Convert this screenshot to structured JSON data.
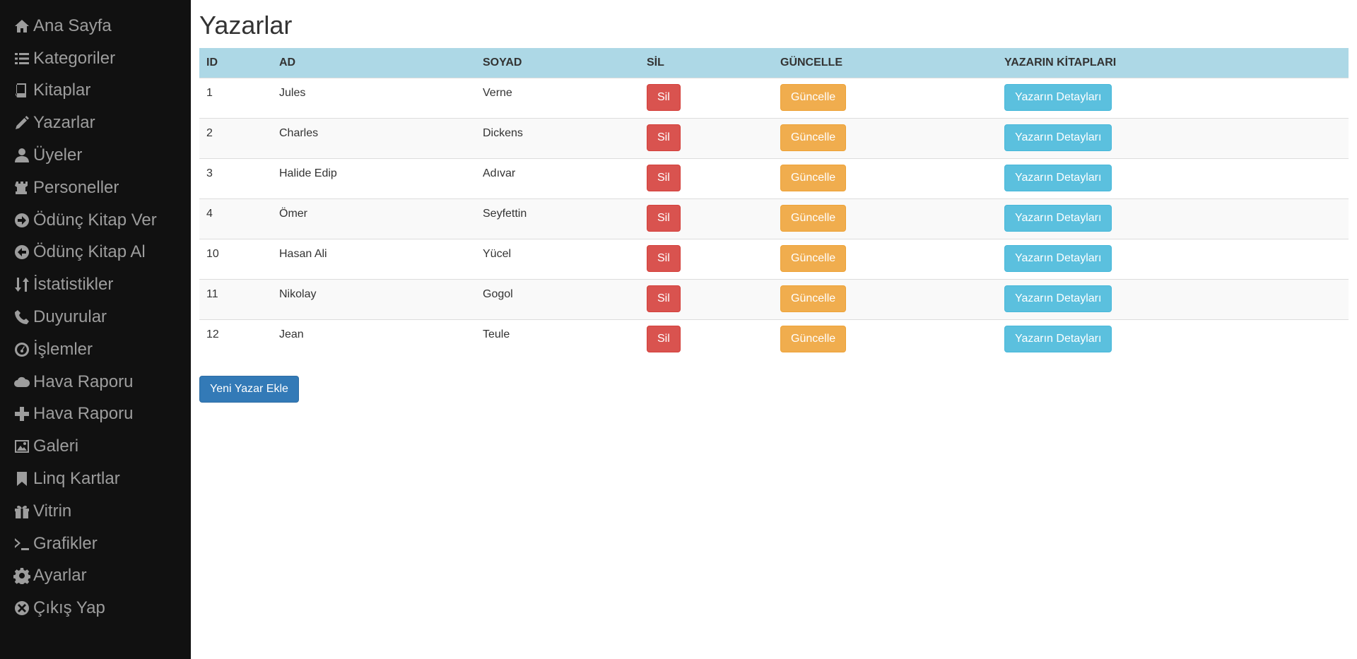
{
  "sidebar": {
    "items": [
      {
        "label": "Ana Sayfa",
        "icon": "home-icon"
      },
      {
        "label": "Kategoriler",
        "icon": "list-icon"
      },
      {
        "label": "Kitaplar",
        "icon": "book-icon"
      },
      {
        "label": "Yazarlar",
        "icon": "pencil-icon"
      },
      {
        "label": "Üyeler",
        "icon": "user-icon"
      },
      {
        "label": "Personeller",
        "icon": "tower-icon"
      },
      {
        "label": "Ödünç Kitap Ver",
        "icon": "circle-arrow-right-icon"
      },
      {
        "label": "Ödünç Kitap Al",
        "icon": "circle-arrow-left-icon"
      },
      {
        "label": "İstatistikler",
        "icon": "sort-icon"
      },
      {
        "label": "Duyurular",
        "icon": "phone-icon"
      },
      {
        "label": "İşlemler",
        "icon": "dashboard-icon"
      },
      {
        "label": "Hava Raporu",
        "icon": "cloud-icon"
      },
      {
        "label": "Hava Raporu",
        "icon": "plus-icon"
      },
      {
        "label": "Galeri",
        "icon": "picture-icon"
      },
      {
        "label": "Linq Kartlar",
        "icon": "bookmark-icon"
      },
      {
        "label": "Vitrin",
        "icon": "gift-icon"
      },
      {
        "label": "Grafikler",
        "icon": "console-icon"
      },
      {
        "label": "Ayarlar",
        "icon": "cog-icon"
      },
      {
        "label": "Çıkış Yap",
        "icon": "remove-circle-icon"
      }
    ]
  },
  "page": {
    "title": "Yazarlar"
  },
  "table": {
    "headers": {
      "id": "ID",
      "ad": "AD",
      "soyad": "SOYAD",
      "sil": "SİL",
      "guncelle": "GÜNCELLE",
      "kitaplar": "YAZARIN KİTAPLARI"
    },
    "rows": [
      {
        "id": "1",
        "ad": "Jules",
        "soyad": "Verne"
      },
      {
        "id": "2",
        "ad": "Charles",
        "soyad": "Dickens"
      },
      {
        "id": "3",
        "ad": "Halide Edip",
        "soyad": "Adıvar"
      },
      {
        "id": "4",
        "ad": "Ömer",
        "soyad": "Seyfettin"
      },
      {
        "id": "10",
        "ad": "Hasan Ali",
        "soyad": "Yücel"
      },
      {
        "id": "11",
        "ad": "Nikolay",
        "soyad": "Gogol"
      },
      {
        "id": "12",
        "ad": "Jean",
        "soyad": "Teule"
      }
    ],
    "delete_label": "Sil",
    "update_label": "Güncelle",
    "details_label": "Yazarın Detayları"
  },
  "actions": {
    "add_author_label": "Yeni Yazar Ekle"
  },
  "colors": {
    "sidebar_bg": "#111111",
    "sidebar_text": "#9d9d9d",
    "header_bg": "#add8e6",
    "danger": "#d9534f",
    "warning": "#f0ad4e",
    "info": "#5bc0de",
    "primary": "#337ab7"
  }
}
